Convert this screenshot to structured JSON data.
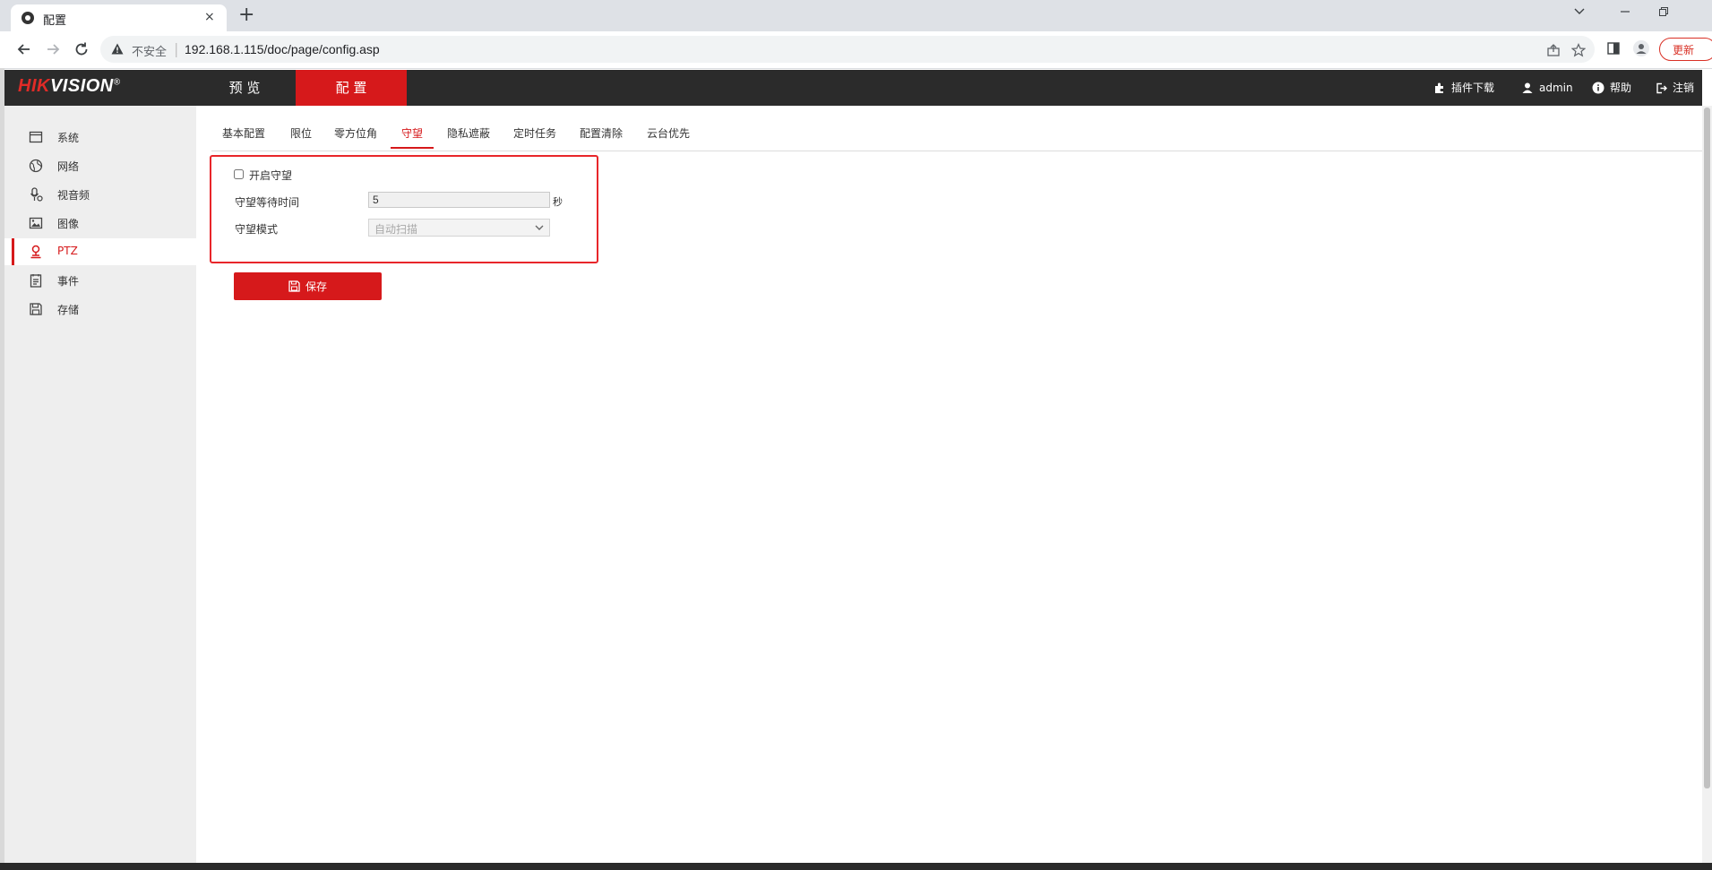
{
  "browser": {
    "tab_title": "配置",
    "tab_close": "×",
    "new_tab": "+",
    "security_label": "不安全",
    "url": "192.168.1.115/doc/page/config.asp",
    "update_label": "更新"
  },
  "header": {
    "logo_prefix": "HIK",
    "logo_suffix": "VISION",
    "logo_mark": "®",
    "nav": {
      "preview": "预 览",
      "config": "配 置"
    },
    "plugin_download": "插件下载",
    "user": "admin",
    "help": "帮助",
    "logout": "注销"
  },
  "sidebar": {
    "items": [
      {
        "label": "系统",
        "icon": "system-icon"
      },
      {
        "label": "网络",
        "icon": "globe-icon"
      },
      {
        "label": "视音频",
        "icon": "mic-icon"
      },
      {
        "label": "图像",
        "icon": "image-icon"
      },
      {
        "label": "PTZ",
        "icon": "ptz-icon",
        "active": true
      },
      {
        "label": "事件",
        "icon": "event-icon"
      },
      {
        "label": "存储",
        "icon": "storage-icon"
      }
    ]
  },
  "tabs": [
    {
      "label": "基本配置"
    },
    {
      "label": "限位"
    },
    {
      "label": "零方位角"
    },
    {
      "label": "守望",
      "active": true
    },
    {
      "label": "隐私遮蔽"
    },
    {
      "label": "定时任务"
    },
    {
      "label": "配置清除"
    },
    {
      "label": "云台优先"
    }
  ],
  "form": {
    "enable_label": "开启守望",
    "enable_checked": false,
    "wait_time_label": "守望等待时间",
    "wait_time_value": "5",
    "wait_time_unit": "秒",
    "mode_label": "守望模式",
    "mode_value": "自动扫描"
  },
  "save_label": "保存",
  "colors": {
    "accent": "#d6191b",
    "header_bg": "#2b2b2b",
    "sidebar_bg": "#eeeeee",
    "highlight_border": "#e8262a"
  }
}
